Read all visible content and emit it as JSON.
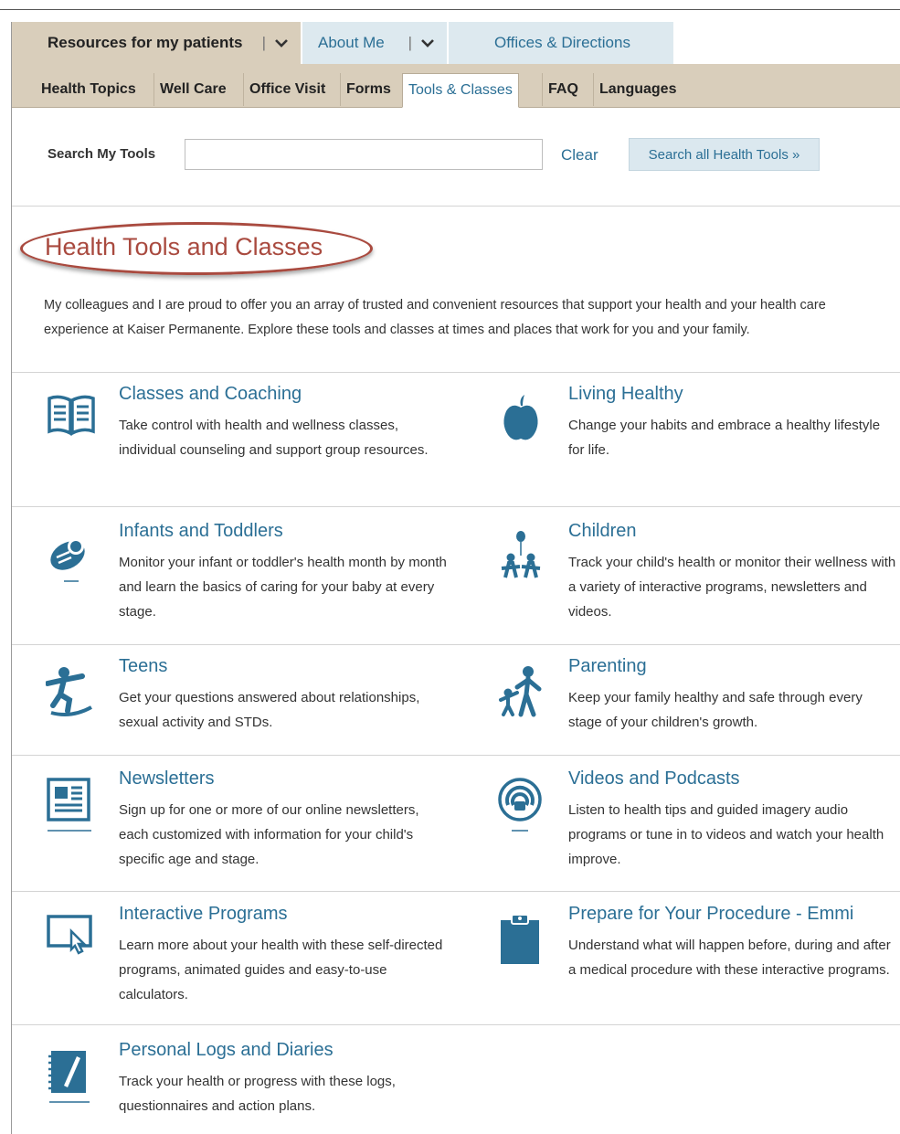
{
  "top_tabs": [
    {
      "label": "Resources for my patients"
    },
    {
      "label": "About Me"
    },
    {
      "label": "Offices & Directions"
    }
  ],
  "separator": "|",
  "sub_tabs": [
    {
      "label": "Health Topics"
    },
    {
      "label": "Well Care"
    },
    {
      "label": "Office Visit"
    },
    {
      "label": "Forms"
    },
    {
      "label": "Tools & Classes",
      "active": true
    },
    {
      "label": "FAQ"
    },
    {
      "label": "Languages"
    }
  ],
  "search": {
    "label": "Search My Tools",
    "value": "",
    "placeholder": "",
    "clear_label": "Clear",
    "button_label": "Search all Health Tools »"
  },
  "page": {
    "title": "Health Tools and Classes",
    "intro": "My colleagues and I are proud to offer you an array of trusted and convenient resources that support your health and your health care experience at Kaiser Permanente. Explore these tools and classes at times and places that work for you and your family."
  },
  "colors": {
    "accent": "#2b6f95",
    "heading": "#a94a3f",
    "tab_bar": "#d9cebb",
    "tab_light": "#dde9ef"
  },
  "items": [
    {
      "title": "Classes and Coaching",
      "desc": "Take control with health and wellness classes, individual counseling and support group resources.",
      "icon": "open-book-icon"
    },
    {
      "title": "Living Healthy",
      "desc": "Change your habits and embrace a healthy lifestyle for life.",
      "icon": "apple-icon"
    },
    {
      "title": "Infants and Toddlers",
      "desc": "Monitor your infant or toddler's health month by month and learn the basics of caring for your baby at every stage.",
      "icon": "baby-icon"
    },
    {
      "title": "Children",
      "desc": "Track your child's health or monitor their wellness with a variety of interactive programs, newsletters and videos.",
      "icon": "children-balloon-icon"
    },
    {
      "title": "Teens",
      "desc": "Get your questions answered about relationships, sexual activity and STDs.",
      "icon": "skateboarder-icon"
    },
    {
      "title": "Parenting",
      "desc": "Keep your family healthy and safe through every stage of your children's growth.",
      "icon": "parent-child-icon"
    },
    {
      "title": "Newsletters",
      "desc": "Sign up for one or more of our online newsletters, each customized with information for your child's specific age and stage.",
      "icon": "newsletter-icon"
    },
    {
      "title": "Videos and Podcasts",
      "desc": "Listen to health tips and guided imagery audio programs or tune in to videos and watch your health improve.",
      "icon": "podcast-icon"
    },
    {
      "title": "Interactive Programs",
      "desc": "Learn more about your health with these self-directed programs, animated guides and easy-to-use calculators.",
      "icon": "monitor-cursor-icon"
    },
    {
      "title": "Prepare for Your Procedure - Emmi",
      "desc": "Understand what will happen before, during and after a medical procedure with these interactive programs.",
      "icon": "clipboard-icon"
    },
    {
      "title": "Personal Logs and Diaries",
      "desc": "Track your health or progress with these logs, questionnaires and action plans.",
      "icon": "notebook-icon"
    }
  ]
}
